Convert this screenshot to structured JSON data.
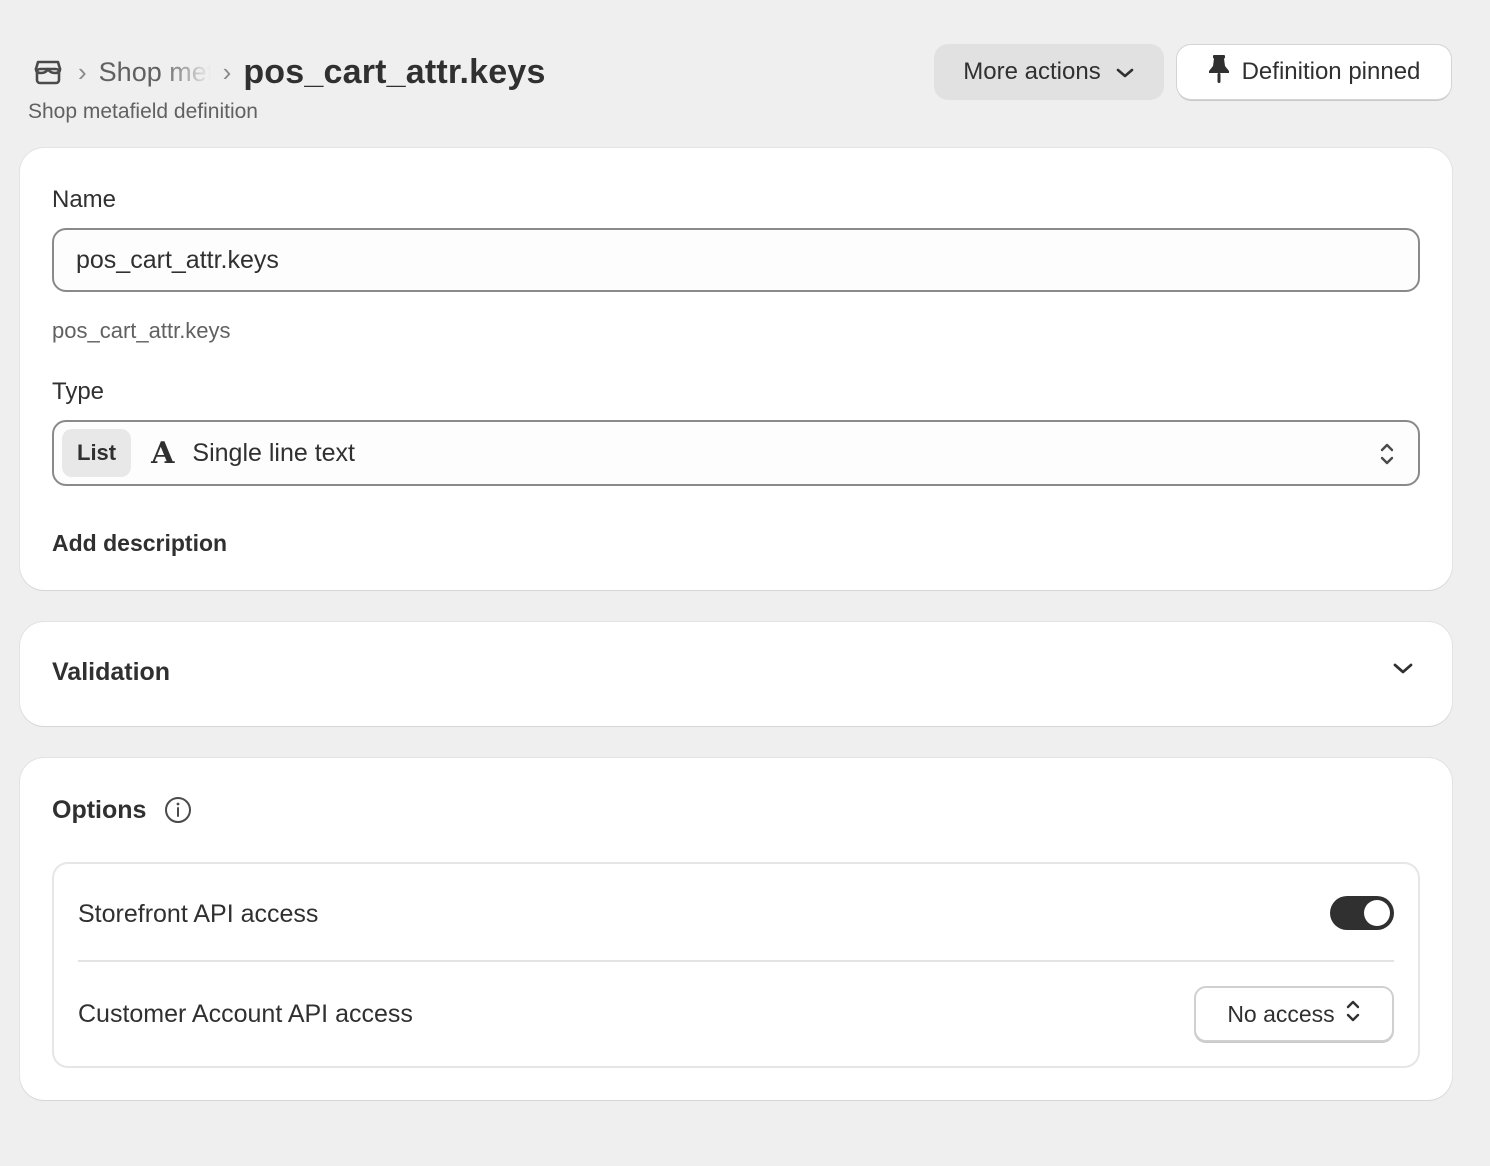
{
  "header": {
    "breadcrumb_link": "Shop metafields",
    "title": "pos_cart_attr.keys",
    "subtitle": "Shop metafield definition",
    "more_actions_label": "More actions",
    "pinned_label": "Definition pinned"
  },
  "definition": {
    "name_label": "Name",
    "name_value": "pos_cart_attr.keys",
    "key_helper": "pos_cart_attr.keys",
    "type_label": "Type",
    "type_list_badge": "List",
    "type_icon_glyph": "A",
    "type_value": "Single line text",
    "add_description_label": "Add description"
  },
  "validation": {
    "title": "Validation"
  },
  "options": {
    "title": "Options",
    "storefront_label": "Storefront API access",
    "storefront_enabled": true,
    "customer_account_label": "Customer Account API access",
    "customer_account_value": "No access"
  },
  "icons": {
    "breadcrumb": "store-icon",
    "more_actions": "chevron-down-icon",
    "pinned": "pin-icon",
    "type_select": "select-chevrons-icon",
    "validation": "chevron-down-icon",
    "options_info": "info-icon",
    "customer_account_select": "select-chevrons-icon"
  },
  "colors": {
    "background": "#efefef",
    "card": "#ffffff",
    "text": "#303030",
    "muted": "#616161",
    "toggle_on": "#303030"
  }
}
